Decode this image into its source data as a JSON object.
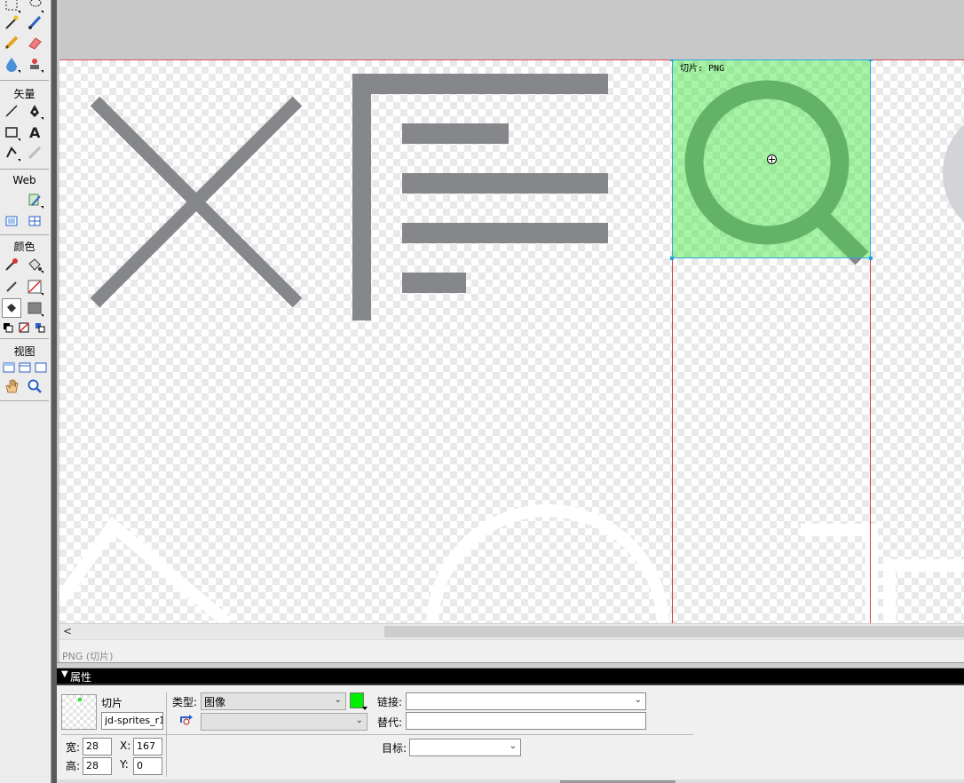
{
  "tools": {
    "sections": {
      "vector": "矢量",
      "web": "Web",
      "colors": "颜色",
      "view": "视图"
    }
  },
  "canvas": {
    "slice_label": "切片: PNG",
    "status_text": "PNG (切片)"
  },
  "properties": {
    "panel_title": "属性",
    "object_type": "切片",
    "slice_name": "jd-sprites_r1",
    "type_label": "类型:",
    "type_value": "图像",
    "link_label": "链接:",
    "link_value": "",
    "alt_label": "替代:",
    "alt_value": "",
    "target_label": "目标:",
    "target_value": "",
    "width_label": "宽:",
    "width_value": "28",
    "height_label": "高:",
    "height_value": "28",
    "x_label": "X:",
    "x_value": "167",
    "y_label": "Y:",
    "y_value": "0"
  },
  "colors": {
    "slice_overlay": "#3ce63c",
    "slice_color": "#00ee00",
    "guide": "#d04040",
    "icon_gray": "#86878b"
  }
}
